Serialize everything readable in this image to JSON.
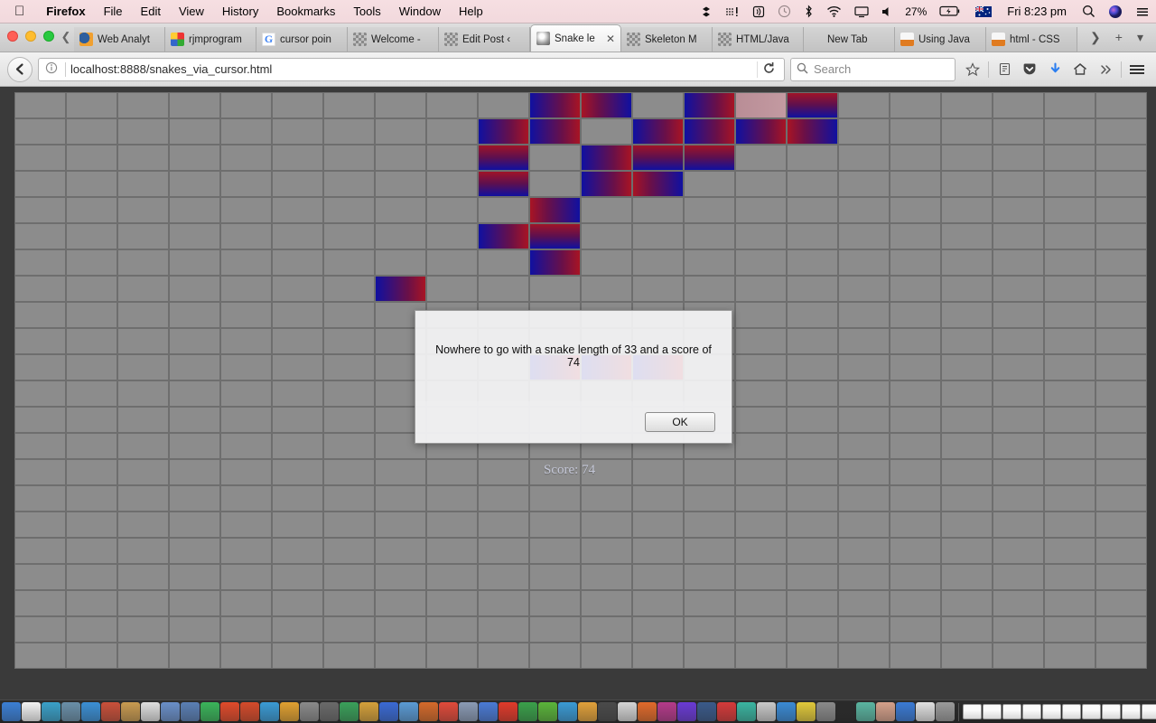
{
  "menubar": {
    "apple_icon": "apple-logo-icon",
    "items": [
      {
        "label": "Firefox",
        "bold": true
      },
      {
        "label": "File",
        "bold": false
      },
      {
        "label": "Edit",
        "bold": false
      },
      {
        "label": "View",
        "bold": false
      },
      {
        "label": "History",
        "bold": false
      },
      {
        "label": "Bookmarks",
        "bold": false
      },
      {
        "label": "Tools",
        "bold": false
      },
      {
        "label": "Window",
        "bold": false
      },
      {
        "label": "Help",
        "bold": false
      }
    ],
    "status": {
      "dropbox_icon": "dropbox-icon",
      "keyboard_icon": "input-source-icon",
      "airplay_audio_icon": "audio-output-icon",
      "timemachine_icon": "time-machine-icon",
      "bluetooth_icon": "bluetooth-icon",
      "wifi_icon": "wifi-icon",
      "screen_icon": "airplay-display-icon",
      "volume_icon": "volume-icon",
      "battery_percent": "27%",
      "battery_icon": "battery-charging-icon",
      "flag_icon": "australia-flag-icon",
      "clock": "Fri 8:23 pm",
      "spotlight_icon": "search-icon",
      "siri_icon": "siri-icon",
      "notification_icon": "notification-center-icon"
    }
  },
  "window_controls": {
    "close": "close-window",
    "minimize": "minimize-window",
    "zoom": "zoom-window"
  },
  "tabs": {
    "scroll_left_icon": "chevron-left-icon",
    "scroll_right_icon": "chevron-right-icon",
    "new_tab_icon": "plus-icon",
    "list_all_tabs_icon": "chevron-down-icon",
    "close_icon": "close-icon",
    "items": [
      {
        "label": "Web Analyt",
        "favicon": "fav-blob",
        "active": false
      },
      {
        "label": "rjmprogram",
        "favicon": "fav-rj",
        "active": false
      },
      {
        "label": "cursor poin",
        "favicon": "fav-g",
        "active": false
      },
      {
        "label": "Welcome -",
        "favicon": "fav-ck",
        "active": false
      },
      {
        "label": "Edit Post ‹",
        "favicon": "fav-ck",
        "active": false
      },
      {
        "label": "Snake le",
        "favicon": "fav-globe",
        "active": true
      },
      {
        "label": "Skeleton M",
        "favicon": "fav-ck",
        "active": false
      },
      {
        "label": "HTML/Java",
        "favicon": "fav-ck",
        "active": false
      },
      {
        "label": "New Tab",
        "favicon": "fav-none",
        "active": false
      },
      {
        "label": "Using Java",
        "favicon": "fav-java",
        "active": false
      },
      {
        "label": "html - CSS",
        "favicon": "fav-java",
        "active": false
      }
    ]
  },
  "toolbar": {
    "back_icon": "back-arrow-icon",
    "identity_icon": "page-info-icon",
    "url": "localhost:8888/snakes_via_cursor.html",
    "reload_icon": "reload-icon",
    "search_icon": "search-icon",
    "search_placeholder": "Search",
    "bookmark_icon": "star-icon",
    "library_icon": "library-icon",
    "pocket_icon": "pocket-icon",
    "downloads_icon": "download-arrow-icon",
    "home_icon": "home-icon",
    "overflow_icon": "double-chevron-icon",
    "menu_icon": "hamburger-menu-icon"
  },
  "game": {
    "columns": 22,
    "rows": 22,
    "score_text": "Score: 74",
    "snake_length": 33,
    "score": 74,
    "colors": {
      "cell": "#8c8c8c",
      "cell_border": "#6e6e6e",
      "snake_blue": "#1010a0",
      "snake_red": "#b41028",
      "food": "#c39aa1",
      "page_background": "#3a3a3a"
    },
    "snake_cells": [
      {
        "c": 10,
        "r": 0,
        "dir": "r1"
      },
      {
        "c": 11,
        "r": 0,
        "dir": "r2"
      },
      {
        "c": 13,
        "r": 0,
        "dir": "r1"
      },
      {
        "c": 15,
        "r": 0,
        "dir": "v1"
      },
      {
        "c": 9,
        "r": 1,
        "dir": "r1"
      },
      {
        "c": 10,
        "r": 1,
        "dir": "r1"
      },
      {
        "c": 12,
        "r": 1,
        "dir": "r1"
      },
      {
        "c": 13,
        "r": 1,
        "dir": "r1"
      },
      {
        "c": 14,
        "r": 1,
        "dir": "r1"
      },
      {
        "c": 15,
        "r": 1,
        "dir": "r2"
      },
      {
        "c": 9,
        "r": 2,
        "dir": "v1"
      },
      {
        "c": 11,
        "r": 2,
        "dir": "r1"
      },
      {
        "c": 12,
        "r": 2,
        "dir": "v1"
      },
      {
        "c": 13,
        "r": 2,
        "dir": "v1"
      },
      {
        "c": 9,
        "r": 3,
        "dir": "v1"
      },
      {
        "c": 11,
        "r": 3,
        "dir": "r1"
      },
      {
        "c": 12,
        "r": 3,
        "dir": "r2"
      },
      {
        "c": 10,
        "r": 4,
        "dir": "r2"
      },
      {
        "c": 9,
        "r": 5,
        "dir": "r1"
      },
      {
        "c": 10,
        "r": 5,
        "dir": "v1"
      },
      {
        "c": 10,
        "r": 6,
        "dir": "r1"
      },
      {
        "c": 7,
        "r": 7,
        "dir": "r1"
      },
      {
        "c": 10,
        "r": 10,
        "dir": "r1"
      },
      {
        "c": 11,
        "r": 10,
        "dir": "r1"
      },
      {
        "c": 12,
        "r": 10,
        "dir": "r1"
      }
    ],
    "food_cells": [
      {
        "c": 14,
        "r": 0
      }
    ]
  },
  "dialog": {
    "message": "Nowhere to go with a snake length of 33 and a score of 74",
    "ok_label": "OK"
  },
  "dock": {
    "app_count": 48,
    "trash_icon": "trash-icon",
    "colors": [
      "#3b7fd4",
      "#f2f2f2",
      "#3aa0c8",
      "#6a8fa8",
      "#3b8fd4",
      "#c8503a",
      "#c89a50",
      "#dedede",
      "#6a8fc8",
      "#5a7fb4",
      "#3ab45a",
      "#e04a2a",
      "#d44a2a",
      "#3a9ad4",
      "#e0a030",
      "#8a8a8a",
      "#6a6a6a",
      "#3aa05a",
      "#d4a03a",
      "#3a6ad4",
      "#5a9ad4",
      "#d46a2a",
      "#e04a3a",
      "#8a9ab4",
      "#4a7ad4",
      "#e03a2a",
      "#3aa04a",
      "#5ab43a",
      "#3a9ad4",
      "#e0a03a",
      "#4a4a4a",
      "#d4d4d4",
      "#e06a2a",
      "#b43a8a",
      "#6a3ad4",
      "#3a5a8a",
      "#d43a3a",
      "#3ab4a0",
      "#c8c8c8",
      "#3a8ad4",
      "#e0c83a",
      "#8a8a8a",
      "#2a2a2a",
      "#5ab4a0",
      "#d4a08a",
      "#3a7ad4",
      "#e0e0e0",
      "#9a9a9a"
    ]
  }
}
